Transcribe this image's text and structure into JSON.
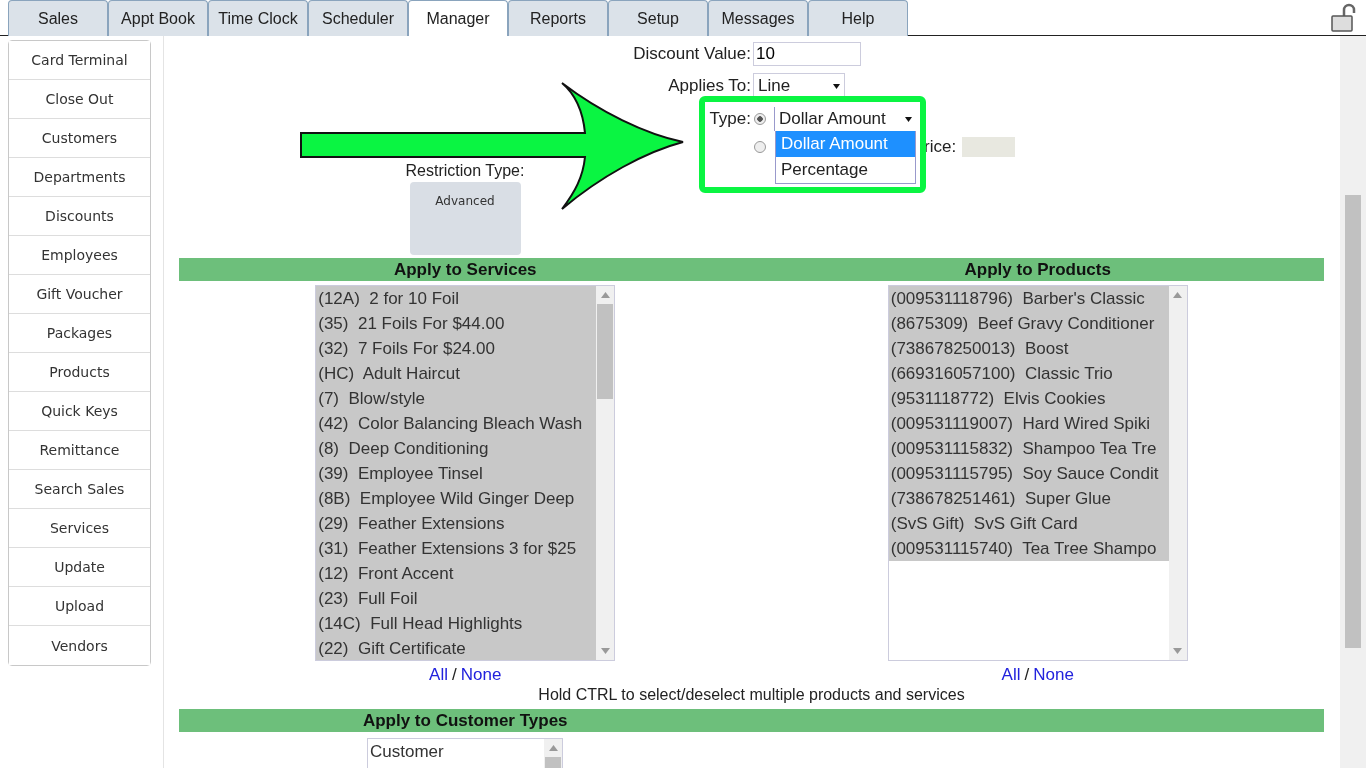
{
  "tabs": [
    {
      "label": "Sales",
      "selected": false
    },
    {
      "label": "Appt Book",
      "selected": false
    },
    {
      "label": "Time Clock",
      "selected": false
    },
    {
      "label": "Scheduler",
      "selected": false
    },
    {
      "label": "Manager",
      "selected": true
    },
    {
      "label": "Reports",
      "selected": false
    },
    {
      "label": "Setup",
      "selected": false
    },
    {
      "label": "Messages",
      "selected": false
    },
    {
      "label": "Help",
      "selected": false
    }
  ],
  "sidebar": {
    "items": [
      "Card Terminal",
      "Close Out",
      "Customers",
      "Departments",
      "Discounts",
      "Employees",
      "Gift Voucher",
      "Packages",
      "Products",
      "Quick Keys",
      "Remittance",
      "Search Sales",
      "Services",
      "Update",
      "Upload",
      "Vendors"
    ]
  },
  "form": {
    "discount_value": {
      "label": "Discount Value:",
      "value": "10"
    },
    "applies_to": {
      "label": "Applies To:",
      "value": "Line"
    },
    "type": {
      "label": "Type:",
      "radios": [
        {
          "selected": true
        },
        {
          "selected": false
        }
      ],
      "value": "Dollar Amount",
      "expanded": true,
      "options": [
        {
          "label": "Dollar Amount",
          "selected": true
        },
        {
          "label": "Percentage",
          "selected": false
        }
      ],
      "price_label": "rice:"
    },
    "restriction_type": {
      "label": "Restriction Type:",
      "button": "Advanced"
    }
  },
  "services": {
    "title": "Apply to Services",
    "all": "All",
    "separator": "/",
    "none": "None",
    "items": [
      {
        "label": "(12A)  2 for 10 Foil",
        "selected": true
      },
      {
        "label": "(35)  21 Foils For $44.00",
        "selected": true
      },
      {
        "label": "(32)  7 Foils For $24.00",
        "selected": true
      },
      {
        "label": "(HC)  Adult Haircut",
        "selected": true
      },
      {
        "label": "(7)  Blow/style",
        "selected": true
      },
      {
        "label": "(42)  Color Balancing Bleach Wash",
        "selected": true
      },
      {
        "label": "(8)  Deep Conditioning",
        "selected": true
      },
      {
        "label": "(39)  Employee Tinsel",
        "selected": true
      },
      {
        "label": "(8B)  Employee Wild Ginger Deep",
        "selected": true
      },
      {
        "label": "(29)  Feather Extensions",
        "selected": true
      },
      {
        "label": "(31)  Feather Extensions 3 for $25",
        "selected": true
      },
      {
        "label": "(12)  Front Accent",
        "selected": true
      },
      {
        "label": "(23)  Full Foil",
        "selected": true
      },
      {
        "label": "(14C)  Full Head Highlights",
        "selected": true
      },
      {
        "label": "(22)  Gift Certificate",
        "selected": true
      }
    ]
  },
  "products": {
    "title": "Apply to Products",
    "all": "All",
    "separator": "/",
    "none": "None",
    "items": [
      {
        "label": "(009531118796)  Barber's Classic",
        "selected": true
      },
      {
        "label": "(8675309)  Beef Gravy Conditioner",
        "selected": true
      },
      {
        "label": "(738678250013)  Boost",
        "selected": true
      },
      {
        "label": "(669316057100)  Classic Trio",
        "selected": true
      },
      {
        "label": "(9531118772)  Elvis Cookies",
        "selected": true
      },
      {
        "label": "(009531119007)  Hard Wired Spiki",
        "selected": true
      },
      {
        "label": "(009531115832)  Shampoo Tea Tre",
        "selected": true
      },
      {
        "label": "(009531115795)  Soy Sauce Condit",
        "selected": true
      },
      {
        "label": "(738678251461)  Super Glue",
        "selected": true
      },
      {
        "label": "(SvS Gift)  SvS Gift Card",
        "selected": true
      },
      {
        "label": "(009531115740)  Tea Tree Shampo",
        "selected": true
      }
    ]
  },
  "hint": "Hold CTRL to select/deselect multiple products and services",
  "customer_types": {
    "title": "Apply to Customer Types",
    "items": [
      {
        "label": "Customer",
        "selected": false
      }
    ]
  }
}
